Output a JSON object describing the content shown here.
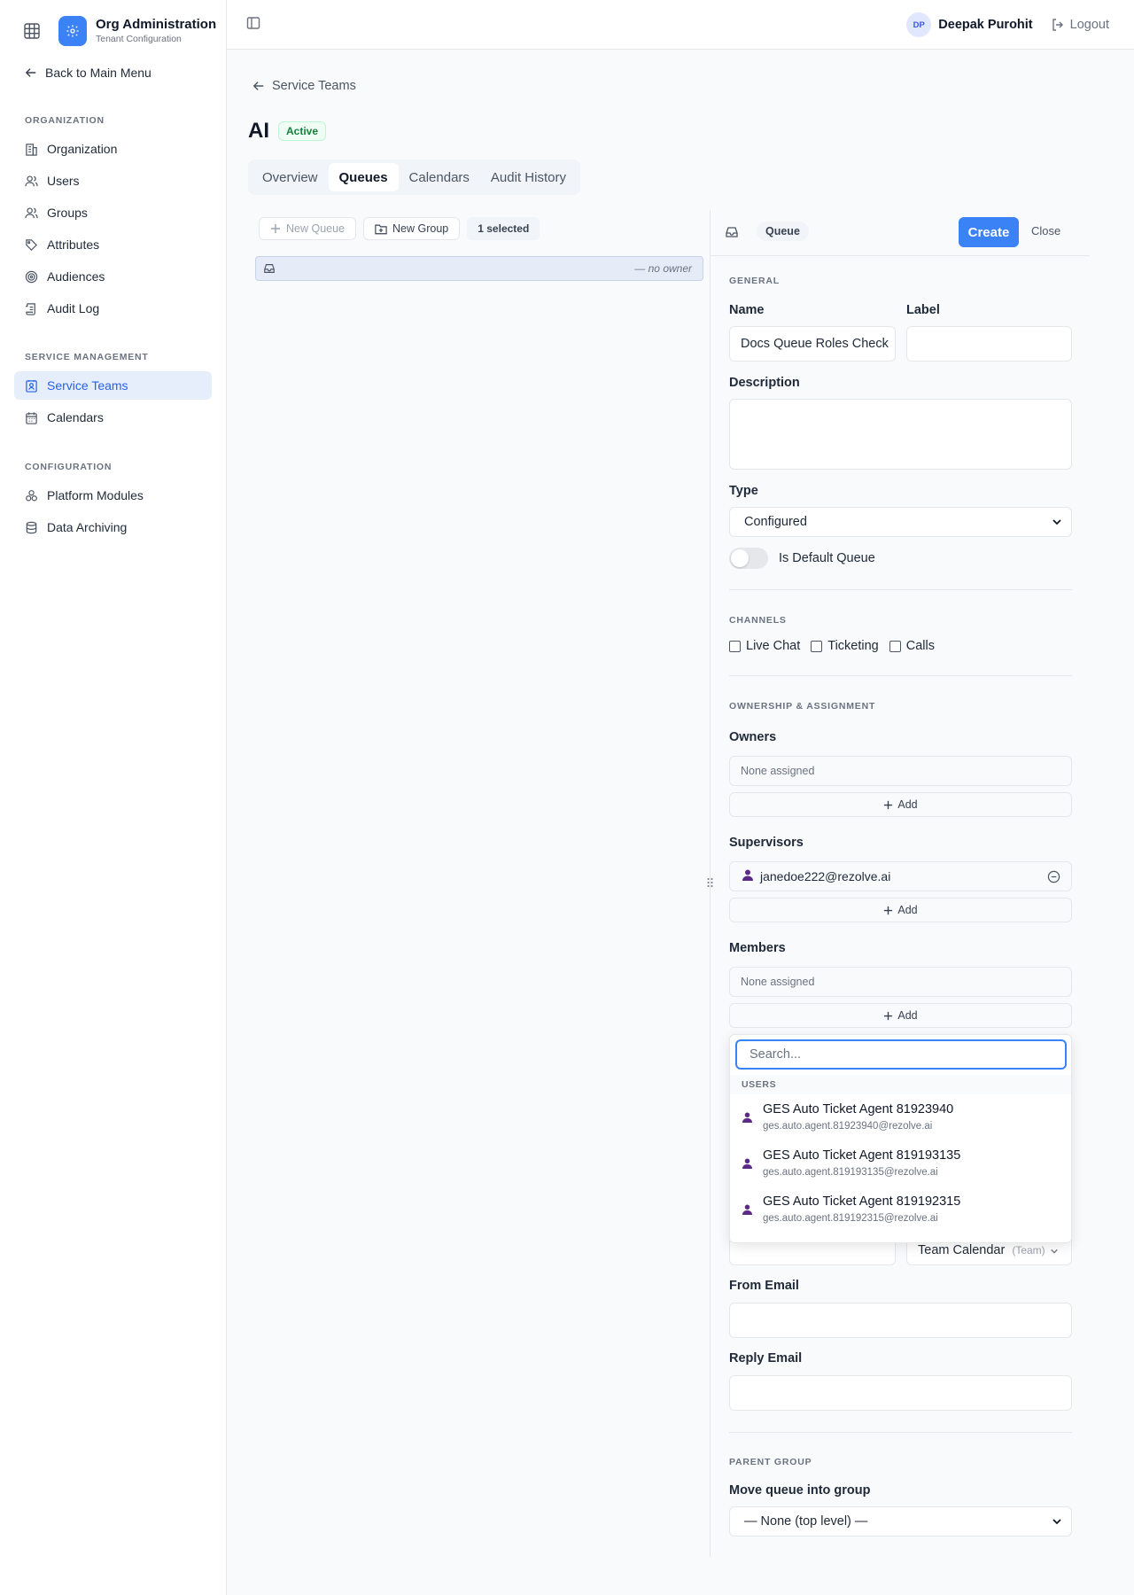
{
  "sidebar": {
    "app_title": "Org Administration",
    "app_subtitle": "Tenant Configuration",
    "back_label": "Back to Main Menu",
    "sections": [
      {
        "title": "ORGANIZATION",
        "items": [
          "Organization",
          "Users",
          "Groups",
          "Attributes",
          "Audiences",
          "Audit Log"
        ]
      },
      {
        "title": "SERVICE MANAGEMENT",
        "items": [
          "Service Teams",
          "Calendars"
        ]
      },
      {
        "title": "CONFIGURATION",
        "items": [
          "Platform Modules",
          "Data Archiving"
        ]
      }
    ],
    "active_item": "Service Teams"
  },
  "header": {
    "user_initials": "DP",
    "user_name": "Deepak Purohit",
    "logout_label": "Logout"
  },
  "main": {
    "breadcrumb": "Service Teams",
    "title": "AI",
    "status": "Active",
    "tabs": [
      "Overview",
      "Queues",
      "Calendars",
      "Audit History"
    ],
    "active_tab": "Queues",
    "toolbar": {
      "new_queue": "New Queue",
      "new_group": "New Group",
      "selected": "1 selected"
    },
    "queue_row": {
      "owner": "— no owner"
    }
  },
  "panel": {
    "type_chip": "Queue",
    "create_label": "Create",
    "close_label": "Close",
    "general": {
      "title": "GENERAL",
      "name_label": "Name",
      "name_value": "Docs Queue Roles Check",
      "label_label": "Label",
      "label_value": "",
      "description_label": "Description",
      "description_value": "",
      "type_label": "Type",
      "type_value": "Configured",
      "default_toggle_label": "Is Default Queue"
    },
    "channels": {
      "title": "CHANNELS",
      "options": [
        "Live Chat",
        "Ticketing",
        "Calls"
      ]
    },
    "ownership": {
      "title": "OWNERSHIP & ASSIGNMENT",
      "owners_label": "Owners",
      "owners_empty": "None assigned",
      "supervisors_label": "Supervisors",
      "supervisor": "janedoe222@rezolve.ai",
      "members_label": "Members",
      "members_empty": "None assigned",
      "add_label": "Add"
    },
    "picker": {
      "search_placeholder": "Search...",
      "section": "USERS",
      "users": [
        {
          "name": "GES Auto Ticket Agent 81923940",
          "email": "ges.auto.agent.81923940@rezolve.ai"
        },
        {
          "name": "GES Auto Ticket Agent 819193135",
          "email": "ges.auto.agent.819193135@rezolve.ai"
        },
        {
          "name": "GES Auto Ticket Agent 819192315",
          "email": "ges.auto.agent.819192315@rezolve.ai"
        }
      ]
    },
    "calendar": {
      "value": "Team Calendar",
      "tag": "(Team)"
    },
    "from_email_label": "From Email",
    "reply_email_label": "Reply Email",
    "parent_group": {
      "title": "PARENT GROUP",
      "move_label": "Move queue into group",
      "value": "— None (top level) —"
    }
  },
  "colors": {
    "accent": "#3b82f6",
    "active_nav_bg": "#e7eefb",
    "status_green": "#15803d",
    "user_icon": "#5b2a86"
  }
}
